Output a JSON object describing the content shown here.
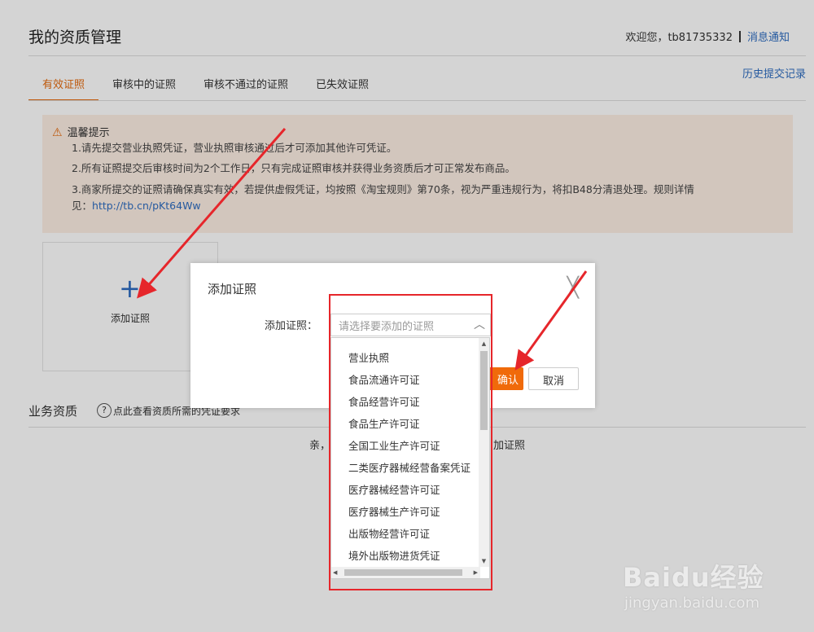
{
  "header": {
    "title": "我的资质管理",
    "welcome": "欢迎您，tb81735332",
    "notifications": "消息通知"
  },
  "tabs": [
    {
      "label": "有效证照",
      "active": true
    },
    {
      "label": "审核中的证照",
      "active": false
    },
    {
      "label": "审核不通过的证照",
      "active": false
    },
    {
      "label": "已失效证照",
      "active": false
    }
  ],
  "history_link": "历史提交记录",
  "notice": {
    "title": "温馨提示",
    "line1": "1.请先提交营业执照凭证，营业执照审核通过后才可添加其他许可凭证。",
    "line2": "2.所有证照提交后审核时间为2个工作日，只有完成证照审核并获得业务资质后才可正常发布商品。",
    "line3a": "3.商家所提交的证照请确保真实有效，若提供虚假凭证，均按照《淘宝规则》第70条，视为严重违规行为，将扣B48分清退处理。规则详情",
    "line3b": "见：",
    "link": "http://tb.cn/pKt64Ww"
  },
  "add_card": {
    "label": "添加证照"
  },
  "business": {
    "title": "业务资质",
    "help": "点此查看资质所需的凭证要求",
    "empty_prefix": "亲，",
    "empty_suffix": "加证照"
  },
  "dialog": {
    "title": "添加证照",
    "field_label": "添加证照：",
    "placeholder": "请选择要添加的证照",
    "confirm": "确认",
    "confirm_visible": "确认",
    "cancel": "取消"
  },
  "dropdown": {
    "options": [
      "营业执照",
      "食品流通许可证",
      "食品经营许可证",
      "食品生产许可证",
      "全国工业生产许可证",
      "二类医疗器械经营备案凭证",
      "医疗器械经营许可证",
      "医疗器械生产许可证",
      "出版物经营许可证",
      "境外出版物进货凭证"
    ]
  },
  "watermark": {
    "brand": "Baidu经验",
    "url": "jingyan.baidu.com"
  },
  "colors": {
    "accent": "#e56a0d",
    "link": "#2d6cc0",
    "annotation": "#e6262b"
  }
}
